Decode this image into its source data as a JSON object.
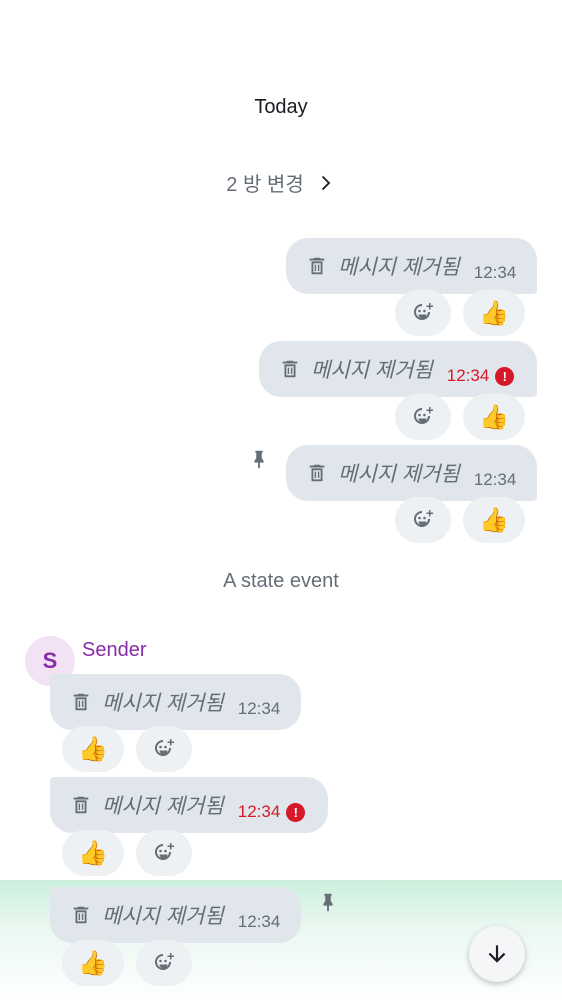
{
  "timeline": {
    "date_separator": "Today",
    "room_changes": "2 방 변경",
    "state_event": "A state event",
    "sender": {
      "initial": "S",
      "name": "Sender"
    },
    "messages": [
      {
        "text": "메시지 제거됨",
        "time": "12:34",
        "reaction": "👍"
      },
      {
        "text": "메시지 제거됨",
        "time": "12:34",
        "error": "!",
        "reaction": "👍"
      },
      {
        "text": "메시지 제거됨",
        "time": "12:34",
        "reaction": "👍"
      },
      {
        "text": "메시지 제거됨",
        "time": "12:34",
        "reaction": "👍"
      },
      {
        "text": "메시지 제거됨",
        "time": "12:34",
        "error": "!",
        "reaction": "👍"
      },
      {
        "text": "메시지 제거됨",
        "time": "12:34",
        "reaction": "👍"
      }
    ]
  },
  "colors": {
    "bubble": "#e1e6ec",
    "pill": "#eef1f4",
    "error": "#d51928",
    "sender": "#8a2ca8",
    "muted": "#656d77"
  },
  "icons": [
    "trash-icon",
    "add-reaction-icon",
    "pin-icon",
    "chevron-right-icon",
    "error-icon",
    "arrow-down-icon"
  ]
}
